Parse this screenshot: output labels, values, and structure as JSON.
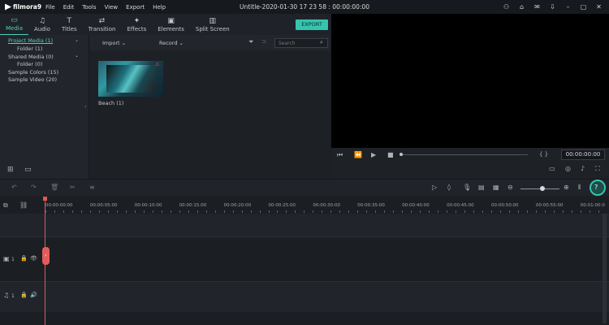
{
  "app": {
    "name": "filmora9",
    "document_title": "Untitle-2020-01-30 17 23 58 : 00:00:00:00"
  },
  "menu": [
    "File",
    "Edit",
    "Tools",
    "View",
    "Export",
    "Help"
  ],
  "tabs": [
    {
      "label": "Media",
      "icon": "folder-icon",
      "active": true
    },
    {
      "label": "Audio",
      "icon": "music-note-icon"
    },
    {
      "label": "Titles",
      "icon": "text-icon"
    },
    {
      "label": "Transition",
      "icon": "transition-icon"
    },
    {
      "label": "Effects",
      "icon": "effects-icon"
    },
    {
      "label": "Elements",
      "icon": "image-icon"
    },
    {
      "label": "Split Screen",
      "icon": "split-screen-icon"
    }
  ],
  "export_label": "EXPORT",
  "library": {
    "items": [
      {
        "label": "Project Media (1)",
        "selected": true
      },
      {
        "label": "Folder (1)"
      },
      {
        "label": "Shared Media (0)"
      },
      {
        "label": "Folder (0)"
      },
      {
        "label": "Sample Colors (15)"
      },
      {
        "label": "Sample Video (20)"
      }
    ]
  },
  "media_toolbar": {
    "import": "Import",
    "record": "Record",
    "search_placeholder": "Search"
  },
  "media_items": [
    {
      "label": "Beach (1)"
    }
  ],
  "preview": {
    "timecode": "00:00:00:00",
    "brackets": "{   }"
  },
  "ruler_labels": [
    "00:00:00:00",
    "00:00:05:00",
    "00:00:10:00",
    "00:00:15:00",
    "00:00:20:00",
    "00:00:25:00",
    "00:00:30:00",
    "00:00:35:00",
    "00:00:40:00",
    "00:00:45:00",
    "00:00:50:00",
    "00:00:55:00",
    "00:01:00:0"
  ],
  "tracks": [
    {
      "type": "video",
      "number": "1"
    },
    {
      "type": "audio",
      "number": "1"
    }
  ],
  "colors": {
    "accent": "#35c4ad",
    "playhead": "#e35656",
    "bg": "#1b1f24"
  }
}
